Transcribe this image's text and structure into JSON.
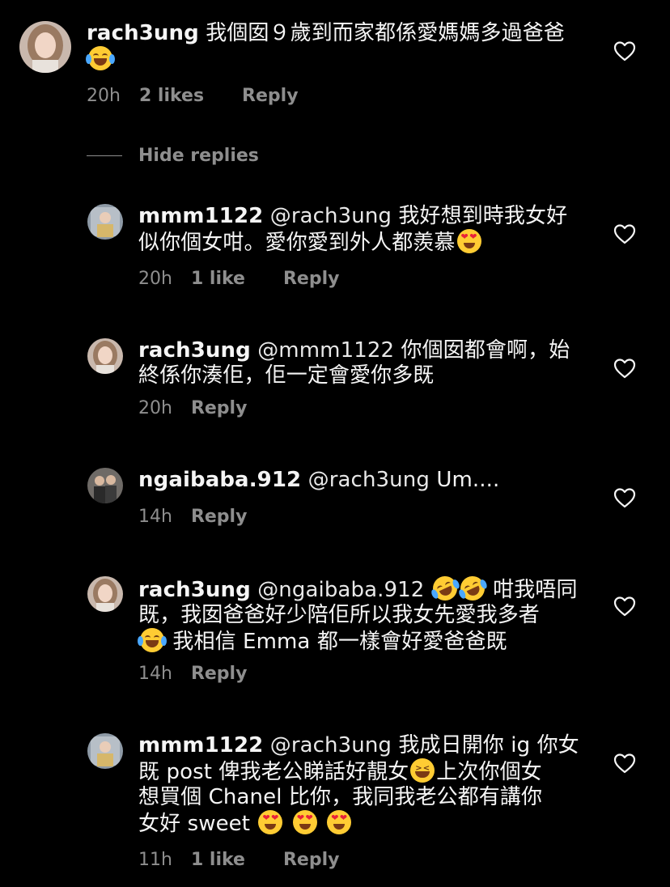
{
  "comments": [
    {
      "username": "rach3ung",
      "text": "我個囡９歲到而家都係愛媽媽多過爸爸",
      "emojis": [
        "face-with-tears-of-joy"
      ],
      "time": "20h",
      "likes": "2 likes",
      "reply_label": "Reply"
    }
  ],
  "hide_replies_label": "Hide replies",
  "replies": [
    {
      "username": "mmm1122",
      "mention": "@rach3ung",
      "text_part1": "我好想到時我女好",
      "text_part2": "似你個女咁。愛你愛到外人都羨慕",
      "time": "20h",
      "likes": "1 like",
      "reply_label": "Reply"
    },
    {
      "username": "rach3ung",
      "mention": "@mmm1122",
      "text_part1": " 你個囡都會啊，始",
      "text_part2": "終係你湊佢，佢一定會愛你多既",
      "time": "20h",
      "reply_label": "Reply"
    },
    {
      "username": "ngaibaba.912",
      "mention": "@rach3ung",
      "text_part1": "Um....",
      "time": "14h",
      "reply_label": "Reply"
    },
    {
      "username": "rach3ung",
      "mention": "@ngaibaba.912",
      "text_part1": "咁我唔同",
      "text_part2": "既，我囡爸爸好少陪佢所以我女先愛我多者",
      "text_part3": "我相信 Emma 都一樣會好愛爸爸既",
      "time": "14h",
      "reply_label": "Reply"
    },
    {
      "username": "mmm1122",
      "mention": "@rach3ung",
      "text_part1": "我成日開你 ig 你女",
      "text_part2": "既 post 俾我老公睇話好靚女",
      "text_part3": "上次你個女",
      "text_part4": "想買個 Chanel 比你，我同我老公都有講你",
      "text_part5": "女好 sweet",
      "time": "11h",
      "likes": "1 like",
      "reply_label": "Reply"
    }
  ],
  "colors": {
    "background": "#000000",
    "text": "#f5f5f5",
    "secondary": "#8e8e8e"
  },
  "icons": {
    "like": "heart-outline-icon"
  }
}
